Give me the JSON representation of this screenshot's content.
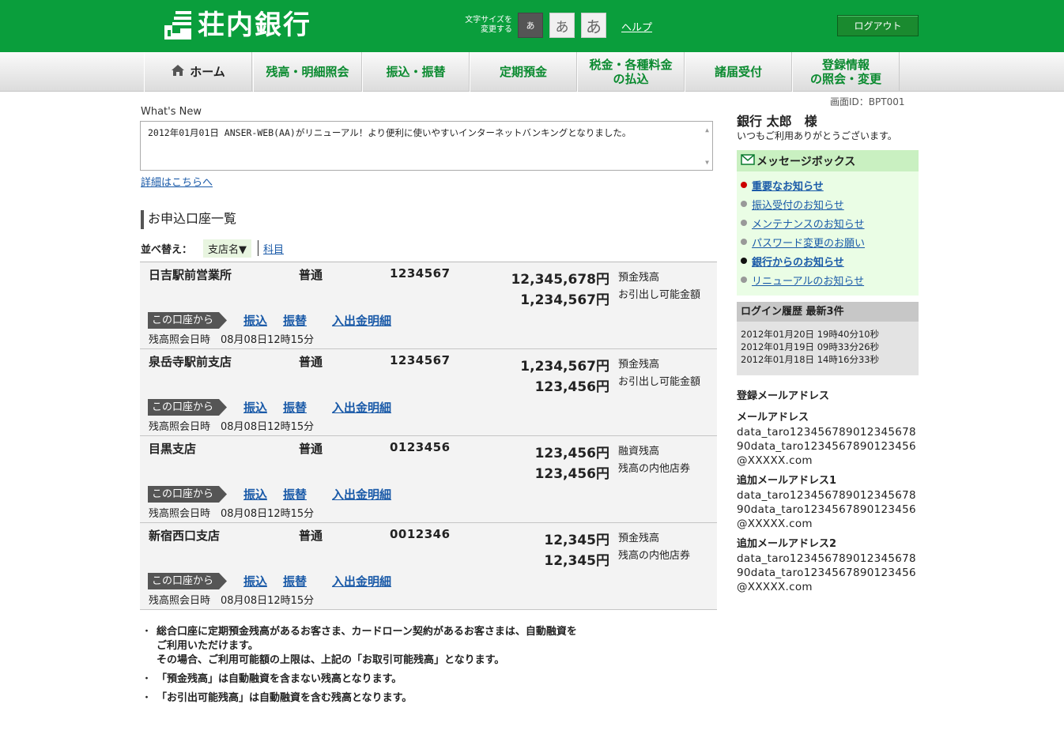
{
  "header": {
    "logo_text": "荘内銀行",
    "fontsize_label_1": "文字サイズを",
    "fontsize_label_2": "変更する",
    "fontsize_small": "あ",
    "fontsize_medium": "あ",
    "fontsize_large": "あ",
    "help": "ヘルプ",
    "logout": "ログアウト"
  },
  "nav": {
    "home": "ホーム",
    "balance": "残高・明細照会",
    "transfer": "振込・振替",
    "time_deposit": "定期預金",
    "tax_line1": "税金・各種料金",
    "tax_line2": "の払込",
    "forms": "諸届受付",
    "reg_line1": "登録情報",
    "reg_line2": "の照会・変更"
  },
  "screen_id": "画面ID：BPT001",
  "whats_new": {
    "label": "What's New",
    "text": "2012年01月01日 ANSER-WEB(AA)がリニューアル！より便利に使いやすいインターネットバンキングとなりました。",
    "detail_link": "詳細はこちらへ"
  },
  "accounts_section": {
    "title": "お申込口座一覧",
    "sort_label": "並べ替え：",
    "sort_branch": "支店名▼",
    "sort_subject": "科目"
  },
  "accounts": [
    {
      "branch": "日吉駅前営業所",
      "type": "普通",
      "number": "1234567",
      "amount1": "12,345,678円",
      "label1": "預金残高",
      "amount2": "1,234,567円",
      "label2": "お引出し可能金額",
      "from": "この口座から",
      "link_transfer": "振込",
      "link_switch": "振替",
      "link_detail": "入出金明細",
      "date": "残高照会日時　08月08日12時15分"
    },
    {
      "branch": "泉岳寺駅前支店",
      "type": "普通",
      "number": "1234567",
      "amount1": "1,234,567円",
      "label1": "預金残高",
      "amount2": "123,456円",
      "label2": "お引出し可能金額",
      "from": "この口座から",
      "link_transfer": "振込",
      "link_switch": "振替",
      "link_detail": "入出金明細",
      "date": "残高照会日時　08月08日12時15分"
    },
    {
      "branch": "目黒支店",
      "type": "普通",
      "number": "0123456",
      "amount1": "123,456円",
      "label1": "融資残高",
      "amount2": "123,456円",
      "label2": "残高の内他店券",
      "from": "この口座から",
      "link_transfer": "振込",
      "link_switch": "振替",
      "link_detail": "入出金明細",
      "date": "残高照会日時　08月08日12時15分"
    },
    {
      "branch": "新宿西口支店",
      "type": "普通",
      "number": "0012346",
      "amount1": "12,345円",
      "label1": "預金残高",
      "amount2": "12,345円",
      "label2": "残高の内他店券",
      "from": "この口座から",
      "link_transfer": "振込",
      "link_switch": "振替",
      "link_detail": "入出金明細",
      "date": "残高照会日時　08月08日12時15分"
    }
  ],
  "notes": {
    "n1_line1": "総合口座に定期預金残高があるお客さま、カードローン契約があるお客さまは、自動融資を",
    "n1_line2": "ご利用いただけます。",
    "n1_line3": "その場合、ご利用可能額の上限は、上記の「お取引可能残高」となります。",
    "n2": "「預金残高」は自動融資を含まない残高となります。",
    "n3": "「お引出可能残高」は自動融資を含む残高となります。"
  },
  "user": {
    "name": "銀行 太郎　様",
    "greeting": "いつもご利用ありがとうございます。"
  },
  "message_box": {
    "title": "メッセージボックス",
    "items": [
      {
        "label": "重要なお知らせ",
        "dot": "#cc0000"
      },
      {
        "label": "振込受付のお知らせ",
        "dot": "#999999"
      },
      {
        "label": "メンテナンスのお知らせ",
        "dot": "#999999"
      },
      {
        "label": "パスワード変更のお願い",
        "dot": "#999999"
      },
      {
        "label": "銀行からのお知らせ",
        "dot": "#111111"
      },
      {
        "label": "リニューアルのお知らせ",
        "dot": "#999999"
      }
    ]
  },
  "login_history": {
    "title": "ログイン履歴 最新3件",
    "entries": [
      "2012年01月20日 19時40分10秒",
      "2012年01月19日 09時33分26秒",
      "2012年01月18日 14時16分33秒"
    ]
  },
  "mail": {
    "title": "登録メールアドレス",
    "label_main": "メールアドレス",
    "addr_main": "data_taro12345678901234567890data_taro1234567890123456@XXXXX.com",
    "label_add1": "追加メールアドレス1",
    "addr_add1": "data_taro12345678901234567890data_taro1234567890123456@XXXXX.com",
    "label_add2": "追加メールアドレス2",
    "addr_add2": "data_taro12345678901234567890data_taro1234567890123456@XXXXX.com"
  },
  "colors": {
    "brand_green": "#0a9e3c",
    "link_blue": "#1a5aa8",
    "message_bg": "#eafde5"
  }
}
